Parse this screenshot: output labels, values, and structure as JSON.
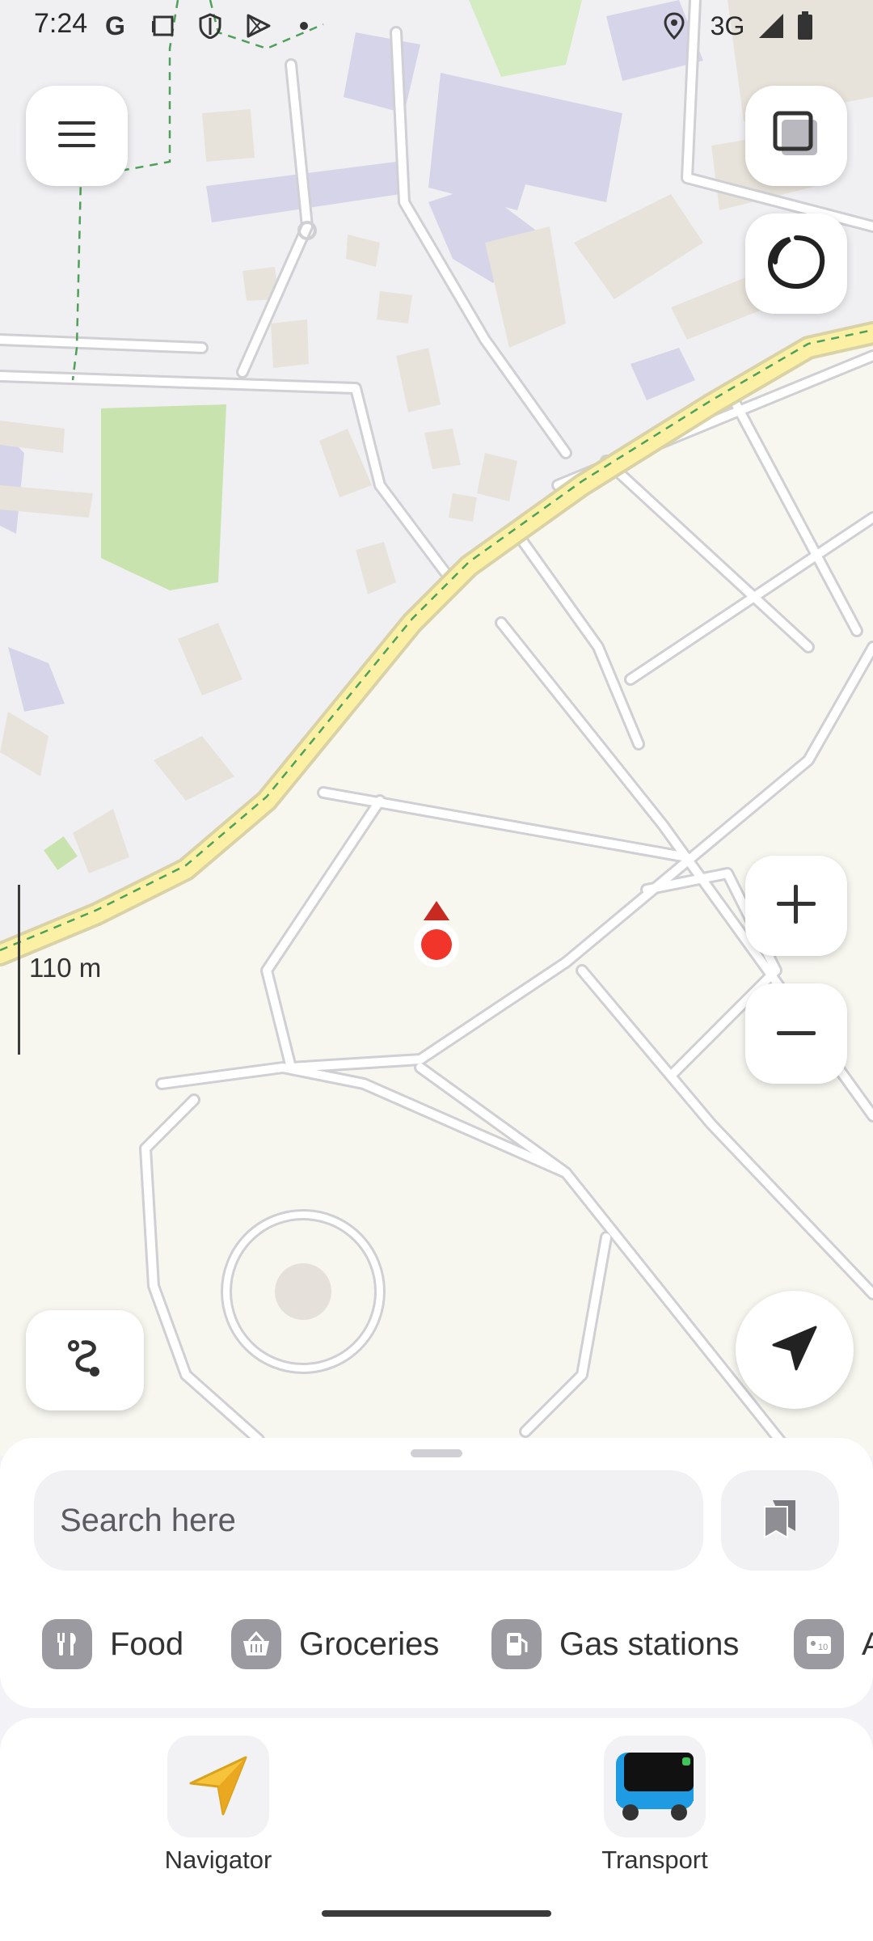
{
  "status_bar": {
    "time": "7:24",
    "network": "3G",
    "icons": [
      "google-icon",
      "screenshot-icon",
      "shield-icon",
      "play-icon",
      "dot-icon",
      "location-icon",
      "signal-icon",
      "battery-icon"
    ]
  },
  "map": {
    "scale_label": "110 m",
    "buttons": [
      "menu-icon",
      "layers-icon",
      "alice-icon",
      "zoom-in-icon",
      "zoom-out-icon",
      "route-icon",
      "navigate-arrow-icon"
    ]
  },
  "search": {
    "placeholder": "Search here"
  },
  "categories": [
    {
      "label": "Food",
      "icon": "fork-knife-icon"
    },
    {
      "label": "Groceries",
      "icon": "basket-icon"
    },
    {
      "label": "Gas stations",
      "icon": "fuel-icon"
    },
    {
      "label": "A",
      "icon": "ticket-icon"
    }
  ],
  "apps": [
    {
      "label": "Navigator",
      "icon": "navigator-icon"
    },
    {
      "label": "Transport",
      "icon": "bus-icon"
    }
  ],
  "colors": {
    "park": "#f7f7f0",
    "urban": "#f0f0f3",
    "road": "#ffffff",
    "road_outline": "#d0d0d4",
    "building": "#e6e1d9",
    "building_purple": "#d6d4e8",
    "green": "#c8e3ae",
    "highway": "#fbf0a3",
    "location_dot": "#f2352a",
    "heading": "#c62a20"
  }
}
